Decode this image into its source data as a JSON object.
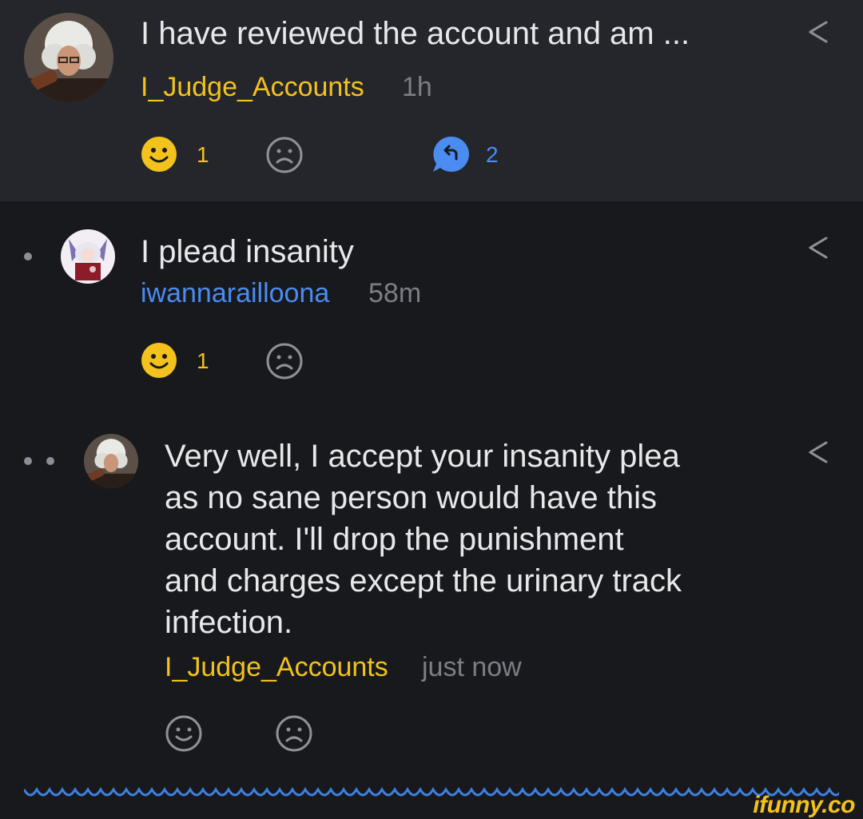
{
  "post": {
    "text": "I have reviewed the account and am ...",
    "username": "I_Judge_Accounts",
    "time": "1h",
    "smile_count": "1",
    "reply_count": "2"
  },
  "reply1": {
    "text": "I plead insanity",
    "username": "iwannarailloona",
    "time": "58m",
    "smile_count": "1"
  },
  "reply2": {
    "text": "Very well, I accept your insanity plea\nas no sane person would have this\naccount. I'll drop the punishment\nand charges except the urinary track\ninfection.",
    "username": "I_Judge_Accounts",
    "time": "just now"
  },
  "watermark": "ifunny.co",
  "colors": {
    "background": "#18191d",
    "card": "#25262b",
    "accent_yellow": "#f3c21c",
    "accent_blue": "#4a8cf0",
    "muted": "#7c7e85"
  },
  "icons": {
    "smile": "smile-face-icon",
    "unsmile": "unsmile-face-icon",
    "reply": "reply-bubble-icon",
    "share": "share-icon"
  }
}
